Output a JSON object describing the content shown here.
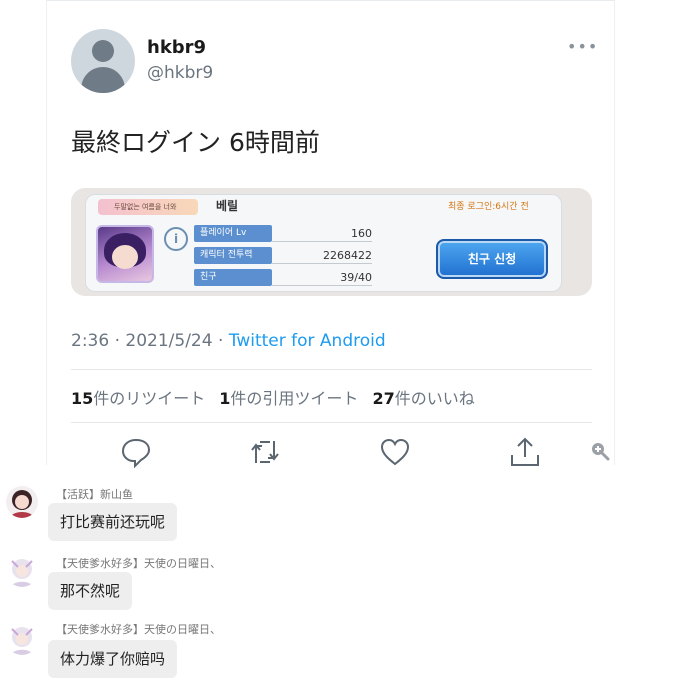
{
  "tweet": {
    "display_name": "hkbr9",
    "handle": "@hkbr9",
    "more_label": "•••",
    "text": "最終ログイン 6時間前",
    "card": {
      "title_badge": "두말없는 여름을 너와",
      "player_name": "베릴",
      "last_login": "최종 로그인:6시간 전",
      "stats": [
        {
          "label": "플레이어 Lv",
          "value": "160"
        },
        {
          "label": "캐릭터 전투력",
          "value": "2268422"
        },
        {
          "label": "친구",
          "value": "39/40"
        }
      ],
      "friend_button": "친구 신청",
      "info_icon": "i"
    },
    "time": "2:36 · 2021/5/24 · ",
    "source": "Twitter for Android",
    "retweets_count": "15",
    "retweets_label": "件のリツイート",
    "quotes_count": "1",
    "quotes_label": "件の引用ツイート",
    "likes_count": "27",
    "likes_label": "件のいいね",
    "actions": [
      "reply-icon",
      "retweet-icon",
      "like-icon",
      "share-icon"
    ],
    "accent_color": "#1d9bf0"
  },
  "comments": [
    {
      "meta": "【活跃】新山鱼",
      "text": "打比赛前还玩呢"
    },
    {
      "meta": "【天使爹水好多】天使の日曜日、",
      "text": "那不然呢"
    },
    {
      "meta": "【天使爹水好多】天使の日曜日、",
      "text": "体力爆了你赔吗"
    }
  ]
}
